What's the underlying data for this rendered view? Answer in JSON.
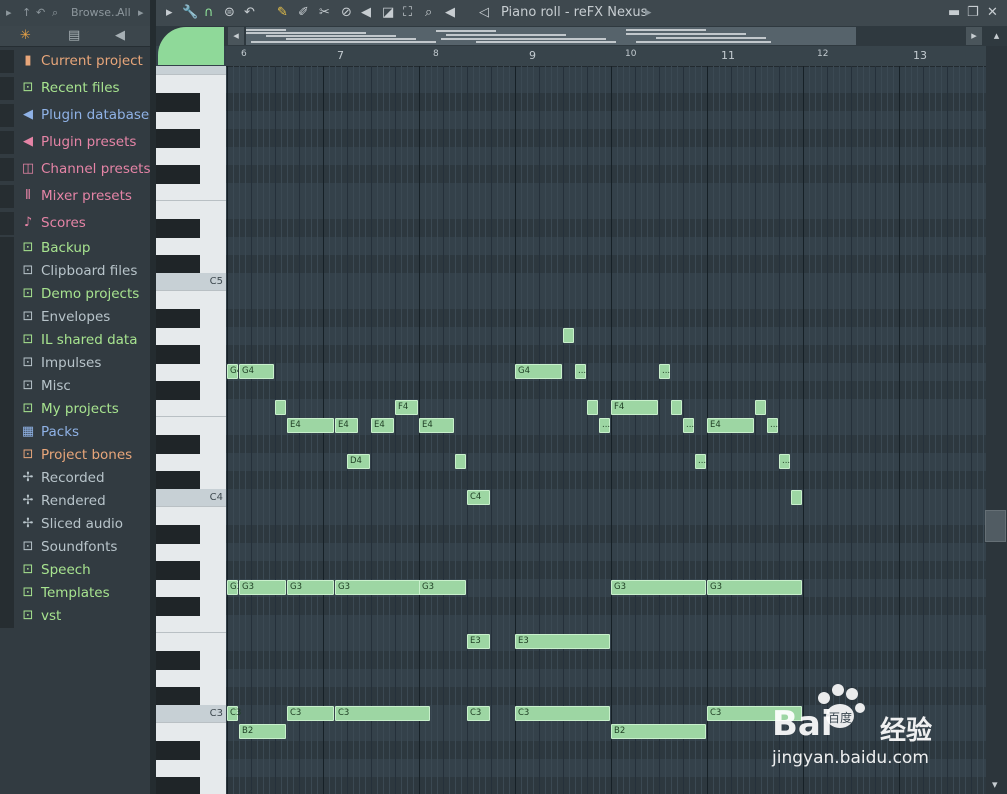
{
  "browser": {
    "toolbar_label": "Browse..",
    "filter_label": "All",
    "items": [
      {
        "label": "Current project",
        "icon": "project-icon",
        "color": "#e8a67a"
      },
      {
        "label": "Recent files",
        "icon": "folder-recent-icon",
        "color": "#a7e38f"
      },
      {
        "label": "Plugin database",
        "icon": "plugin-icon",
        "color": "#8fb2e6"
      },
      {
        "label": "Plugin presets",
        "icon": "plugin-preset-icon",
        "color": "#e584a6"
      },
      {
        "label": "Channel presets",
        "icon": "channel-preset-icon",
        "color": "#e584a6"
      },
      {
        "label": "Mixer presets",
        "icon": "mixer-preset-icon",
        "color": "#e584a6"
      },
      {
        "label": "Scores",
        "icon": "note-icon",
        "color": "#e584a6"
      },
      {
        "label": "Backup",
        "icon": "folder-backup-icon",
        "color": "#a7e38f"
      },
      {
        "label": "Clipboard files",
        "icon": "folder-icon",
        "color": "#b8c4ca"
      },
      {
        "label": "Demo projects",
        "icon": "folder-icon",
        "color": "#a7e38f"
      },
      {
        "label": "Envelopes",
        "icon": "folder-icon",
        "color": "#b8c4ca"
      },
      {
        "label": "IL shared data",
        "icon": "folder-icon",
        "color": "#a7e38f"
      },
      {
        "label": "Impulses",
        "icon": "folder-icon",
        "color": "#b8c4ca"
      },
      {
        "label": "Misc",
        "icon": "folder-icon",
        "color": "#b8c4ca"
      },
      {
        "label": "My projects",
        "icon": "folder-icon",
        "color": "#a7e38f"
      },
      {
        "label": "Packs",
        "icon": "packs-icon",
        "color": "#8fb2e6"
      },
      {
        "label": "Project bones",
        "icon": "folder-icon",
        "color": "#e8a67a"
      },
      {
        "label": "Recorded",
        "icon": "waveform-icon",
        "color": "#b8c4ca"
      },
      {
        "label": "Rendered",
        "icon": "waveform-icon",
        "color": "#b8c4ca"
      },
      {
        "label": "Sliced audio",
        "icon": "waveform-icon",
        "color": "#b8c4ca"
      },
      {
        "label": "Soundfonts",
        "icon": "folder-icon",
        "color": "#b8c4ca"
      },
      {
        "label": "Speech",
        "icon": "folder-icon",
        "color": "#a7e38f"
      },
      {
        "label": "Templates",
        "icon": "folder-icon",
        "color": "#a7e38f"
      },
      {
        "label": "vst",
        "icon": "folder-icon",
        "color": "#a7e38f"
      }
    ]
  },
  "piano_roll": {
    "title": "Piano roll - reFX Nexus",
    "bar_numbers": [
      "6",
      "7",
      "8",
      "9",
      "10",
      "11",
      "12",
      "13"
    ],
    "key_labels": [
      "C5",
      "C4",
      "C3"
    ],
    "notes": [
      {
        "label": "G4",
        "bar": 6.0,
        "len": 0.125,
        "pitch": 67
      },
      {
        "label": "G4",
        "bar": 6.125,
        "len": 0.375,
        "pitch": 67
      },
      {
        "label": "",
        "bar": 6.5,
        "len": 0.125,
        "pitch": 65
      },
      {
        "label": "E4",
        "bar": 6.625,
        "len": 0.5,
        "pitch": 64
      },
      {
        "label": "E4",
        "bar": 7.125,
        "len": 0.25,
        "pitch": 64
      },
      {
        "label": "D4",
        "bar": 7.25,
        "len": 0.25,
        "pitch": 62
      },
      {
        "label": "E4",
        "bar": 7.5,
        "len": 0.25,
        "pitch": 64
      },
      {
        "label": "F4",
        "bar": 7.75,
        "len": 0.25,
        "pitch": 65
      },
      {
        "label": "E4",
        "bar": 8.0,
        "len": 0.375,
        "pitch": 64
      },
      {
        "label": "",
        "bar": 8.375,
        "len": 0.125,
        "pitch": 62
      },
      {
        "label": "C4",
        "bar": 8.5,
        "len": 0.25,
        "pitch": 60
      },
      {
        "label": "G4",
        "bar": 9.0,
        "len": 0.5,
        "pitch": 67
      },
      {
        "label": "",
        "bar": 9.5,
        "len": 0.125,
        "pitch": 69
      },
      {
        "label": "...",
        "bar": 9.625,
        "len": 0.125,
        "pitch": 67
      },
      {
        "label": "",
        "bar": 9.75,
        "len": 0.125,
        "pitch": 65
      },
      {
        "label": "...",
        "bar": 9.875,
        "len": 0.125,
        "pitch": 64
      },
      {
        "label": "F4",
        "bar": 10.0,
        "len": 0.5,
        "pitch": 65
      },
      {
        "label": "...",
        "bar": 10.5,
        "len": 0.125,
        "pitch": 67
      },
      {
        "label": "",
        "bar": 10.625,
        "len": 0.125,
        "pitch": 65
      },
      {
        "label": "...",
        "bar": 10.75,
        "len": 0.125,
        "pitch": 64
      },
      {
        "label": "...",
        "bar": 10.875,
        "len": 0.125,
        "pitch": 62
      },
      {
        "label": "E4",
        "bar": 11.0,
        "len": 0.5,
        "pitch": 64
      },
      {
        "label": "",
        "bar": 11.5,
        "len": 0.125,
        "pitch": 65
      },
      {
        "label": "...",
        "bar": 11.625,
        "len": 0.125,
        "pitch": 64
      },
      {
        "label": "...",
        "bar": 11.75,
        "len": 0.125,
        "pitch": 62
      },
      {
        "label": "",
        "bar": 11.875,
        "len": 0.125,
        "pitch": 60
      },
      {
        "label": "G3",
        "bar": 6.0,
        "len": 0.125,
        "pitch": 55
      },
      {
        "label": "G3",
        "bar": 6.125,
        "len": 0.5,
        "pitch": 55
      },
      {
        "label": "G3",
        "bar": 6.625,
        "len": 0.5,
        "pitch": 55
      },
      {
        "label": "G3",
        "bar": 7.125,
        "len": 1.0,
        "pitch": 55
      },
      {
        "label": "G3",
        "bar": 8.0,
        "len": 0.5,
        "pitch": 55
      },
      {
        "label": "G3",
        "bar": 10.0,
        "len": 1.0,
        "pitch": 55
      },
      {
        "label": "G3",
        "bar": 11.0,
        "len": 1.0,
        "pitch": 55
      },
      {
        "label": "E3",
        "bar": 8.5,
        "len": 0.25,
        "pitch": 52
      },
      {
        "label": "E3",
        "bar": 9.0,
        "len": 1.0,
        "pitch": 52
      },
      {
        "label": "C3",
        "bar": 6.0,
        "len": 0.125,
        "pitch": 48
      },
      {
        "label": "C3",
        "bar": 6.625,
        "len": 0.5,
        "pitch": 48
      },
      {
        "label": "C3",
        "bar": 7.125,
        "len": 1.0,
        "pitch": 48
      },
      {
        "label": "C3",
        "bar": 8.5,
        "len": 0.25,
        "pitch": 48
      },
      {
        "label": "C3",
        "bar": 9.0,
        "len": 1.0,
        "pitch": 48
      },
      {
        "label": "C3",
        "bar": 11.0,
        "len": 1.0,
        "pitch": 48
      },
      {
        "label": "B2",
        "bar": 6.125,
        "len": 0.5,
        "pitch": 47
      },
      {
        "label": "B2",
        "bar": 10.0,
        "len": 1.0,
        "pitch": 47
      }
    ]
  },
  "watermark": {
    "brand": "Bai",
    "brand_suffix": "百度",
    "product": "经验",
    "url": "jingyan.baidu.com"
  }
}
